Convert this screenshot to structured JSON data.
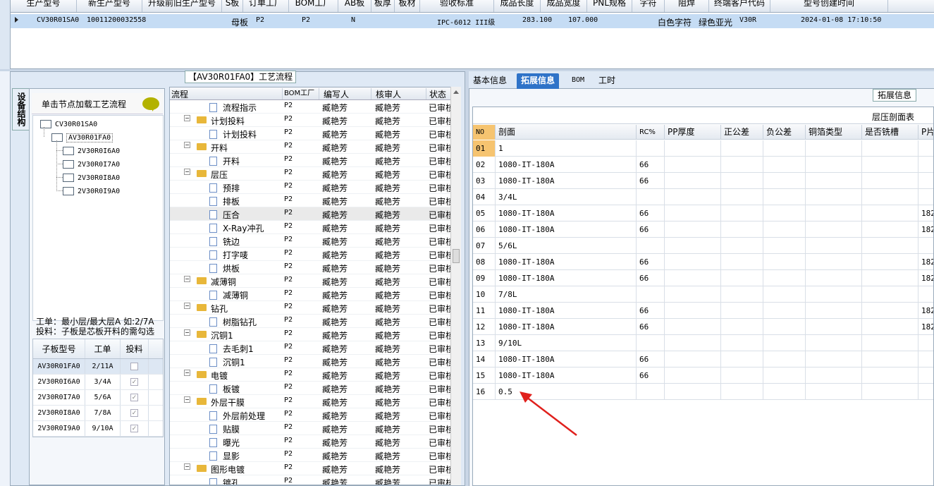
{
  "top_table": {
    "headers": [
      "生产型号",
      "新生产型号",
      "升级前旧生产型号",
      "S板",
      "订单工厂",
      "BOM工厂",
      "AB板",
      "板厚",
      "板材",
      "验收标准",
      "成品长度",
      "成品宽度",
      "PNL规格",
      "字符",
      "阻焊",
      "终端客户代码",
      "型号创建时间"
    ],
    "row": {
      "生产型号": "CV30R01SA0",
      "新生产型号": "10011200032558",
      "S板": "母板",
      "订单工厂": "P2",
      "BOM工厂": "P2",
      "AB板": "N",
      "验收标准": "IPC-6012 III级",
      "成品长度": "283.100",
      "成品宽度": "107.000",
      "字符": "白色字符",
      "阻焊": "绿色亚光",
      "终端客户代码": "V30R",
      "型号创建时间": "2024-01-08 17:10:50"
    }
  },
  "left_panel": {
    "title": "【AV30R01FA0】工艺流程",
    "vertical_tab": "设备结构",
    "click_hint": "单击节点加载工艺流程",
    "tree": {
      "root": "CV30R01SA0",
      "child": "AV30R01FA0",
      "leaves": [
        "2V30R0I6A0",
        "2V30R0I7A0",
        "2V30R0I8A0",
        "2V30R0I9A0"
      ]
    },
    "note_line1": "工单：最小层/最大层A 如:2/7A",
    "note_line2": "投料：子板是芯板开料的需勾选",
    "subboard_table": {
      "headers": [
        "子板型号",
        "工单",
        "投料"
      ],
      "rows": [
        {
          "model": "AV30R01FA0",
          "order": "2/11A",
          "feed": false
        },
        {
          "model": "2V30R0I6A0",
          "order": "3/4A",
          "feed": true
        },
        {
          "model": "2V30R0I7A0",
          "order": "5/6A",
          "feed": true
        },
        {
          "model": "2V30R0I8A0",
          "order": "7/8A",
          "feed": true
        },
        {
          "model": "2V30R0I9A0",
          "order": "9/10A",
          "feed": true
        }
      ]
    }
  },
  "process_table": {
    "headers": [
      "流程",
      "BOM工厂",
      "编写人",
      "核审人",
      "状态"
    ],
    "rows": [
      {
        "name": "流程指示",
        "kind": "doc",
        "bom": "P2",
        "writer": "臧艳芳",
        "reviewer": "臧艳芳",
        "status": "已审核"
      },
      {
        "name": "计划投料",
        "kind": "folder",
        "bom": "P2",
        "writer": "臧艳芳",
        "reviewer": "臧艳芳",
        "status": "已审核"
      },
      {
        "name": "计划投料",
        "kind": "doc",
        "bom": "P2",
        "writer": "臧艳芳",
        "reviewer": "臧艳芳",
        "status": "已审核"
      },
      {
        "name": "开料",
        "kind": "folder",
        "bom": "P2",
        "writer": "臧艳芳",
        "reviewer": "臧艳芳",
        "status": "已审核"
      },
      {
        "name": "开料",
        "kind": "doc",
        "bom": "P2",
        "writer": "臧艳芳",
        "reviewer": "臧艳芳",
        "status": "已审核"
      },
      {
        "name": "层压",
        "kind": "folder",
        "bom": "P2",
        "writer": "臧艳芳",
        "reviewer": "臧艳芳",
        "status": "已审核"
      },
      {
        "name": "预排",
        "kind": "doc",
        "bom": "P2",
        "writer": "臧艳芳",
        "reviewer": "臧艳芳",
        "status": "已审核"
      },
      {
        "name": "排板",
        "kind": "doc",
        "bom": "P2",
        "writer": "臧艳芳",
        "reviewer": "臧艳芳",
        "status": "已审核"
      },
      {
        "name": "压合",
        "kind": "doc",
        "bom": "P2",
        "writer": "臧艳芳",
        "reviewer": "臧艳芳",
        "status": "已审核"
      },
      {
        "name": "X-Ray冲孔",
        "kind": "doc",
        "bom": "P2",
        "writer": "臧艳芳",
        "reviewer": "臧艳芳",
        "status": "已审核"
      },
      {
        "name": "铣边",
        "kind": "doc",
        "bom": "P2",
        "writer": "臧艳芳",
        "reviewer": "臧艳芳",
        "status": "已审核"
      },
      {
        "name": "打字唛",
        "kind": "doc",
        "bom": "P2",
        "writer": "臧艳芳",
        "reviewer": "臧艳芳",
        "status": "已审核"
      },
      {
        "name": "烘板",
        "kind": "doc",
        "bom": "P2",
        "writer": "臧艳芳",
        "reviewer": "臧艳芳",
        "status": "已审核"
      },
      {
        "name": "减薄铜",
        "kind": "folder",
        "bom": "P2",
        "writer": "臧艳芳",
        "reviewer": "臧艳芳",
        "status": "已审核"
      },
      {
        "name": "减薄铜",
        "kind": "doc",
        "bom": "P2",
        "writer": "臧艳芳",
        "reviewer": "臧艳芳",
        "status": "已审核"
      },
      {
        "name": "钻孔",
        "kind": "folder",
        "bom": "P2",
        "writer": "臧艳芳",
        "reviewer": "臧艳芳",
        "status": "已审核"
      },
      {
        "name": "树脂钻孔",
        "kind": "doc",
        "bom": "P2",
        "writer": "臧艳芳",
        "reviewer": "臧艳芳",
        "status": "已审核"
      },
      {
        "name": "沉铜1",
        "kind": "folder",
        "bom": "P2",
        "writer": "臧艳芳",
        "reviewer": "臧艳芳",
        "status": "已审核"
      },
      {
        "name": "去毛刺1",
        "kind": "doc",
        "bom": "P2",
        "writer": "臧艳芳",
        "reviewer": "臧艳芳",
        "status": "已审核"
      },
      {
        "name": "沉铜1",
        "kind": "doc",
        "bom": "P2",
        "writer": "臧艳芳",
        "reviewer": "臧艳芳",
        "status": "已审核"
      },
      {
        "name": "电镀",
        "kind": "folder",
        "bom": "P2",
        "writer": "臧艳芳",
        "reviewer": "臧艳芳",
        "status": "已审核"
      },
      {
        "name": "板镀",
        "kind": "doc",
        "bom": "P2",
        "writer": "臧艳芳",
        "reviewer": "臧艳芳",
        "status": "已审核"
      },
      {
        "name": "外层干膜",
        "kind": "folder",
        "bom": "P2",
        "writer": "臧艳芳",
        "reviewer": "臧艳芳",
        "status": "已审核"
      },
      {
        "name": "外层前处理",
        "kind": "doc",
        "bom": "P2",
        "writer": "臧艳芳",
        "reviewer": "臧艳芳",
        "status": "已审核"
      },
      {
        "name": "贴膜",
        "kind": "doc",
        "bom": "P2",
        "writer": "臧艳芳",
        "reviewer": "臧艳芳",
        "status": "已审核"
      },
      {
        "name": "曝光",
        "kind": "doc",
        "bom": "P2",
        "writer": "臧艳芳",
        "reviewer": "臧艳芳",
        "status": "已审核"
      },
      {
        "name": "显影",
        "kind": "doc",
        "bom": "P2",
        "writer": "臧艳芳",
        "reviewer": "臧艳芳",
        "status": "已审核"
      },
      {
        "name": "图形电镀",
        "kind": "folder",
        "bom": "P2",
        "writer": "臧艳芳",
        "reviewer": "臧艳芳",
        "status": "已审核"
      },
      {
        "name": "镀孔",
        "kind": "doc",
        "bom": "P2",
        "writer": "臧艳芳",
        "reviewer": "臧艳芳",
        "status": "已审核"
      }
    ],
    "highlighted_row": 8
  },
  "right_panel": {
    "tabs": [
      "基本信息",
      "拓展信息",
      "BOM",
      "工时"
    ],
    "active_tab": 1,
    "ext_button": "拓展信息",
    "grid_title": "层压剖面表",
    "headers": [
      "NO",
      "剖面",
      "RC%",
      "PP厚度",
      "正公差",
      "负公差",
      "铜箔类型",
      "是否铣槽",
      "P片"
    ],
    "rows": [
      {
        "no": "01",
        "section": "1",
        "rc": "",
        "p": ""
      },
      {
        "no": "02",
        "section": "1080-IT-180A",
        "rc": "66",
        "p": ""
      },
      {
        "no": "03",
        "section": "1080-IT-180A",
        "rc": "66",
        "p": ""
      },
      {
        "no": "04",
        "section": "3/4L",
        "rc": "",
        "p": ""
      },
      {
        "no": "05",
        "section": "1080-IT-180A",
        "rc": "66",
        "p": "182"
      },
      {
        "no": "06",
        "section": "1080-IT-180A",
        "rc": "66",
        "p": "182"
      },
      {
        "no": "07",
        "section": "5/6L",
        "rc": "",
        "p": ""
      },
      {
        "no": "08",
        "section": "1080-IT-180A",
        "rc": "66",
        "p": "182"
      },
      {
        "no": "09",
        "section": "1080-IT-180A",
        "rc": "66",
        "p": "182"
      },
      {
        "no": "10",
        "section": "7/8L",
        "rc": "",
        "p": ""
      },
      {
        "no": "11",
        "section": "1080-IT-180A",
        "rc": "66",
        "p": "182"
      },
      {
        "no": "12",
        "section": "1080-IT-180A",
        "rc": "66",
        "p": "182"
      },
      {
        "no": "13",
        "section": "9/10L",
        "rc": "",
        "p": ""
      },
      {
        "no": "14",
        "section": "1080-IT-180A",
        "rc": "66",
        "p": ""
      },
      {
        "no": "15",
        "section": "1080-IT-180A",
        "rc": "66",
        "p": ""
      },
      {
        "no": "16",
        "section": "0.5",
        "rc": "",
        "p": ""
      }
    ]
  },
  "colors": {
    "accent": "#2f73c8",
    "selected_row": "#c5dcf4",
    "annotation_arrow": "#e0201c",
    "folder": "#e8b73a"
  }
}
